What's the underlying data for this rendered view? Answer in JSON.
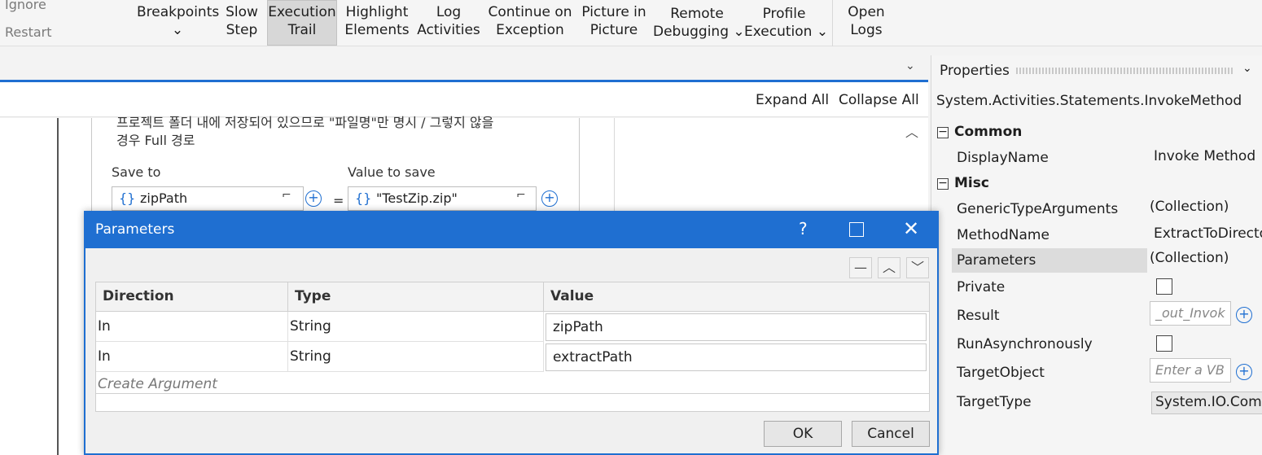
{
  "ribbon": {
    "ignore": "Ignore",
    "restart": "Restart",
    "buttons": [
      {
        "line1": "Breakpoints",
        "line2": "⌄"
      },
      {
        "line1": "Slow",
        "line2": "Step"
      },
      {
        "line1": "Execution",
        "line2": "Trail"
      },
      {
        "line1": "Highlight",
        "line2": "Elements"
      },
      {
        "line1": "Log",
        "line2": "Activities"
      },
      {
        "line1": "Continue on",
        "line2": "Exception"
      },
      {
        "line1": "Picture in",
        "line2": "Picture"
      },
      {
        "line1": "Remote",
        "line2": "Debugging ⌄"
      },
      {
        "line1": "Profile",
        "line2": "Execution ⌄"
      },
      {
        "line1": "Open",
        "line2": "Logs"
      }
    ]
  },
  "designer": {
    "expand_all": "Expand All",
    "collapse_all": "Collapse All",
    "korean_line1": "프로젝트 폴더 내에 저장되어 있으므로 \"파일명\"만 명시 / 그렇지 않을",
    "korean_line2": "경우 Full 경로",
    "save_to_label": "Save to",
    "value_to_save_label": "Value to save",
    "save_to_value": "zipPath",
    "value_to_save_value": "\"TestZip.zip\"",
    "equals": "="
  },
  "properties": {
    "title": "Properties",
    "type_name": "System.Activities.Statements.InvokeMethod",
    "sections": {
      "common": "Common",
      "misc": "Misc"
    },
    "rows": [
      {
        "name": "DisplayName",
        "value": "Invoke Method"
      },
      {
        "name": "GenericTypeArguments",
        "value": "(Collection)"
      },
      {
        "name": "MethodName",
        "value": "ExtractToDirecto"
      },
      {
        "name": "Parameters",
        "value": "(Collection)"
      },
      {
        "name": "Private",
        "value": ""
      },
      {
        "name": "Result",
        "value": "_out_Invok"
      },
      {
        "name": "RunAsynchronously",
        "value": ""
      },
      {
        "name": "TargetObject",
        "value": "Enter a VB"
      },
      {
        "name": "TargetType",
        "value": "System.IO.Comp"
      }
    ]
  },
  "dialog": {
    "title": "Parameters",
    "help": "?",
    "columns": [
      "Direction",
      "Type",
      "Value"
    ],
    "rows": [
      {
        "direction": "In",
        "type": "String",
        "value": "zipPath"
      },
      {
        "direction": "In",
        "type": "String",
        "value": "extractPath"
      }
    ],
    "create_argument": "Create Argument",
    "ok": "OK",
    "cancel": "Cancel"
  },
  "colors": {
    "accent": "#1f6fd1"
  }
}
